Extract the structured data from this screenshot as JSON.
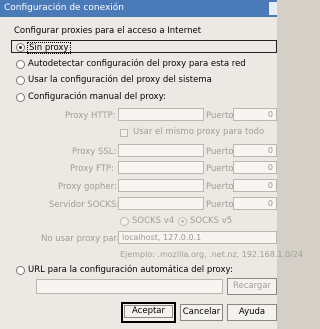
{
  "window": {
    "title": "Configuración de conexión"
  },
  "group_label": "Configurar proxies para el acceso a Internet",
  "options": {
    "no_proxy": "Sin proxy",
    "auto_detect": "Autodetectar configuración del proxy para esta red",
    "system": "Usar la configuración del proxy del sistema",
    "manual": "Configuración manual del proxy:",
    "pac": "URL para la configuración automática del proxy:"
  },
  "manual": {
    "http_label": "Proxy HTTP:",
    "port_label": "Puerto:",
    "same_proxy": "Usar el mismo proxy para todo",
    "ssl_label": "Proxy SSL:",
    "ftp_label": "Proxy FTP:",
    "gopher_label": "Proxy gopher:",
    "socks_label": "Servidor SOCKS:",
    "port_values": [
      "0",
      "0",
      "0",
      "0",
      "0"
    ],
    "socks_v4": "SOCKS v4",
    "socks_v5": "SOCKS v5",
    "no_proxy_label": "No usar proxy para:",
    "no_proxy_value": "localhost, 127.0.0.1",
    "example": "Ejemplo: .mozilla.org, .net.nz, 192.168.1.0/24"
  },
  "pac": {
    "reload": "Recargar"
  },
  "buttons": {
    "ok": "Aceptar",
    "cancel": "Cancelar",
    "help": "Ayuda"
  }
}
